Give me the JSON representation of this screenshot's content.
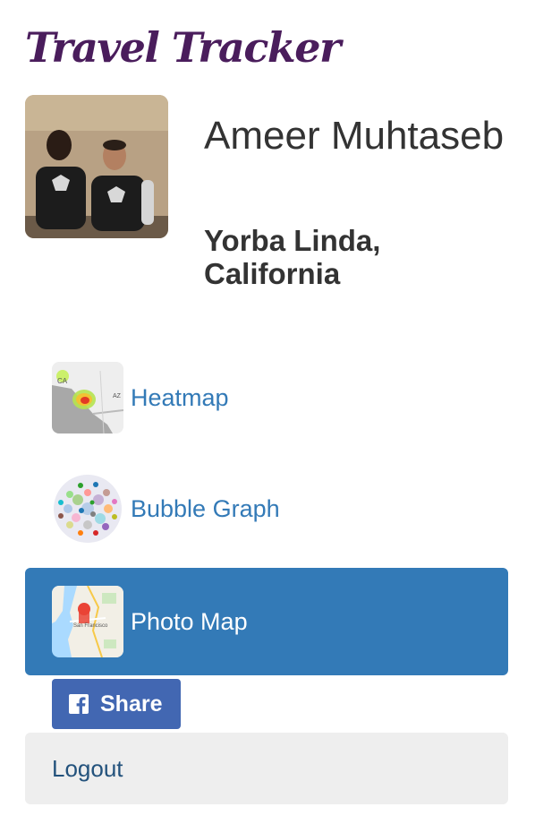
{
  "app": {
    "title": "Travel Tracker"
  },
  "profile": {
    "name": "Ameer Muhtaseb",
    "location": "Yorba Linda, California",
    "avatar": "profile-photo"
  },
  "nav": {
    "items": [
      {
        "label": "Heatmap",
        "icon": "heatmap-thumbnail",
        "active": false
      },
      {
        "label": "Bubble Graph",
        "icon": "bubble-graph-thumbnail",
        "active": false
      },
      {
        "label": "Photo Map",
        "icon": "photo-map-thumbnail",
        "active": true
      }
    ]
  },
  "share": {
    "label": "Share",
    "icon": "facebook-icon"
  },
  "logout": {
    "label": "Logout"
  },
  "colors": {
    "title": "#4a1d5c",
    "link": "#337ab7",
    "active_bg": "#337ab7",
    "facebook": "#4267b2",
    "logout_bg": "#eeeeee"
  }
}
